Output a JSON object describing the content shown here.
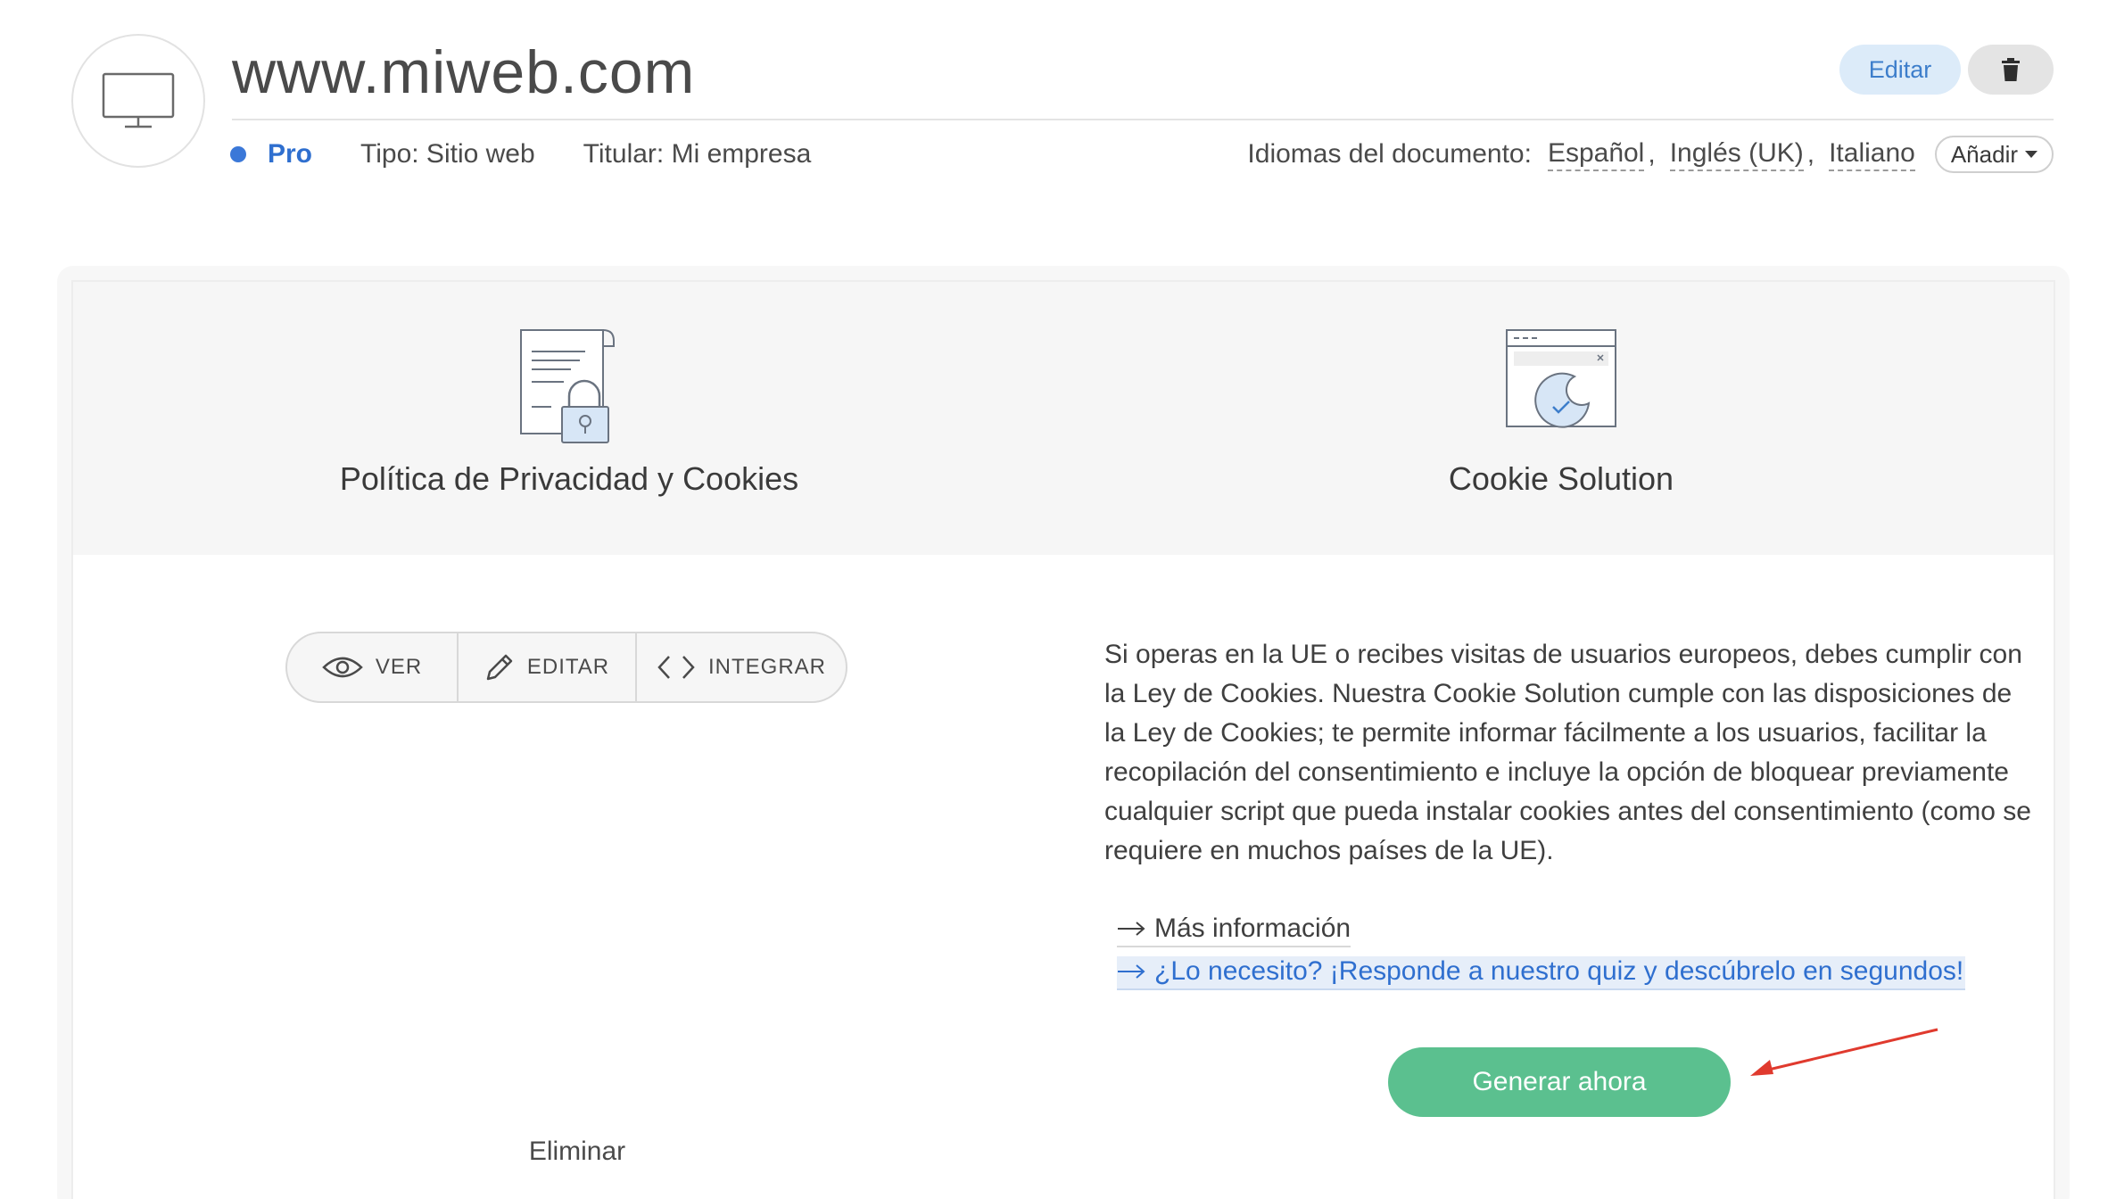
{
  "header": {
    "site_title": "www.miweb.com",
    "edit_label": "Editar",
    "plan": "Pro",
    "type": "Tipo: Sitio web",
    "owner": "Titular: Mi empresa",
    "languages_label": "Idiomas del documento:",
    "languages": [
      "Español",
      "Inglés (UK)",
      "Italiano"
    ],
    "add_label": "Añadir"
  },
  "products": {
    "privacy": {
      "title": "Política de Privacidad y Cookies"
    },
    "cookie": {
      "title": "Cookie Solution"
    }
  },
  "actions": {
    "view": "VER",
    "edit": "EDITAR",
    "embed": "INTEGRAR",
    "delete": "Eliminar"
  },
  "cookie_section": {
    "description": "Si operas en la UE o recibes visitas de usuarios europeos, debes cumplir con la Ley de Cookies. Nuestra Cookie Solution cumple con las disposiciones de la Ley de Cookies; te permite informar fácilmente a los usuarios, facilitar la recopilación del consentimiento e incluye la opción de bloquear previamente cualquier script que pueda instalar cookies antes del consentimiento (como se requiere en muchos países de la UE).",
    "more_info": "Más información",
    "quiz": "¿Lo necesito? ¡Responde a nuestro quiz y descúbrelo en segundos!",
    "generate": "Generar ahora"
  },
  "colors": {
    "accent_blue": "#2f6fcf",
    "generate_green": "#5bc08f",
    "edit_bg": "#dcebf9",
    "annotation_red": "#e03a2e"
  }
}
